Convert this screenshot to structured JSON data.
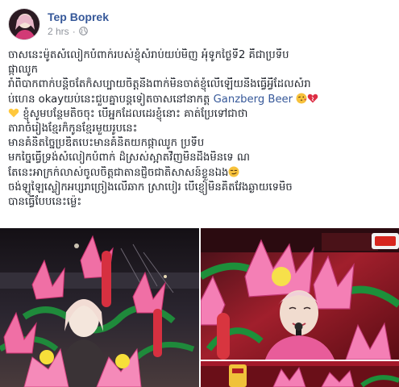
{
  "post": {
    "author": "Tep Boprek",
    "timestamp": "2 hrs",
    "separator": "·",
    "privacy_icon": "globe-icon"
  },
  "text": {
    "l1": "ចាសនេះម៉ូតសំលៀកបំពាក់របស់ខ្ញុំសំរាប់យប់មិញ អុំទូកថ្ងៃទី2 គឺជាប្រទីប",
    "l2": "ផ្កាឈូក",
    "l3": "រាំពិបាកពាក់បន្តិចតែក៏សប្បាយចិត្តនឹងពាក់មិនចាត់ខ្ញុំលើឡើយនឹងធ្វើអ្វីដែលសំរា",
    "l4a": "ប់ហេន okayយប់នេះជួបគ្នាបន្តទៀតចាសនៅនាកត្ត",
    "l4_mention": "Ganzberg Beer",
    "l5": "ខ្ញុំសូមបន្ថែមតិចចុះ បើអ្នកដែលដេរខ្ញុំនោះ គាត់ប្រែទៅជាថា",
    "l6": "តារាចំរៀងខ្មែរក៏កូនខ្មែរមួយរូបនេះ",
    "l7": "មានគំនិតច្នៃប្រឌិតបេះមានគំនិតយកផ្កាឈូក ប្រទីប",
    "l8": "មកច្នៃធ្វើទ្រង់សំលៀកបំពាក់ ដ៏ស្រស់ស្អាតវិញមិនដឹងមិនទេ ណ",
    "l9": "តែនេះអាក្រក់លាស់ចូលចិត្តជាតានជ្ញិចជាតិសាសន៍ខ្លួនឯង",
    "l10": "ចង់ឡូឡៃស្លៀកអប្សរាច្រៀងលើឆាក ស្រាបៀរ បើខ្ញៀមិនគិតវែងឆ្ងាយទេមិច",
    "l11": "បានធ្វើបែបនេះម៉្លេះ"
  },
  "emoji": [
    "winking-kiss-emoji",
    "red-heart-emoji",
    "yellow-heart-emoji",
    "smirk-emoji"
  ],
  "photos": [
    {
      "name": "lotus-costume-photo-1"
    },
    {
      "name": "lotus-costume-photo-2"
    },
    {
      "name": "lotus-costume-photo-3"
    }
  ],
  "colors": {
    "link": "#365899",
    "meta": "#90949c",
    "text": "#1d2129"
  }
}
